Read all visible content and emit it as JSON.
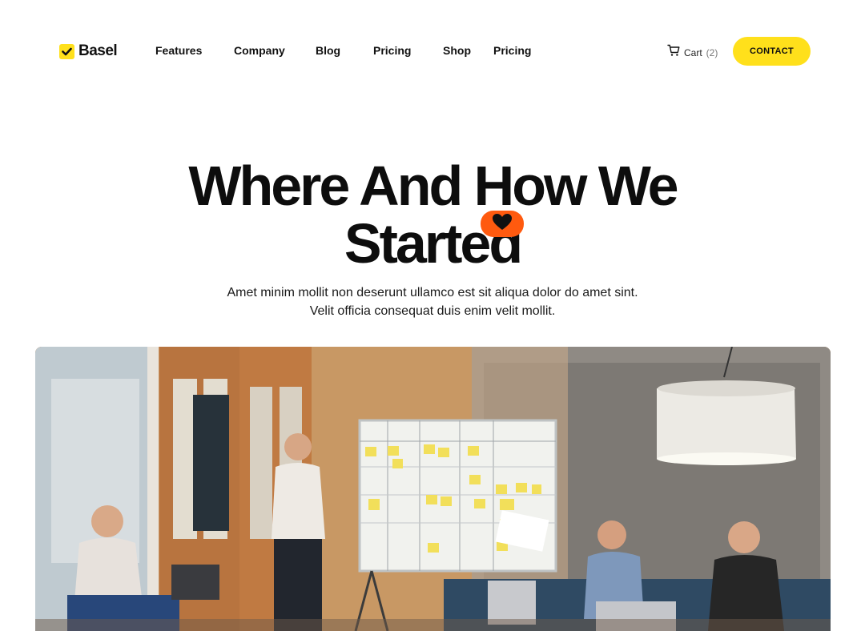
{
  "header": {
    "logo_text": "Basel",
    "nav": [
      {
        "label": "Features"
      },
      {
        "label": "Company"
      },
      {
        "label": "Blog"
      },
      {
        "label": "Pricing"
      },
      {
        "label": "Shop"
      },
      {
        "label": "Pricing"
      }
    ],
    "cart_label": "Cart",
    "cart_count": "(2)",
    "contact_label": "CONTACT"
  },
  "hero": {
    "title_line1": "Where And How We",
    "title_line2": "Started",
    "subtitle_line1": "Amet minim mollit non deserunt ullamco est sit aliqua dolor do amet sint.",
    "subtitle_line2": "Velit officia consequat duis enim velit mollit."
  },
  "colors": {
    "accent_yellow": "#FFE01B",
    "accent_orange": "#FF5A0F",
    "text_dark": "#111111"
  },
  "icons": {
    "logo_mark": "check-icon",
    "cart": "cart-icon",
    "badge": "heart-icon"
  }
}
